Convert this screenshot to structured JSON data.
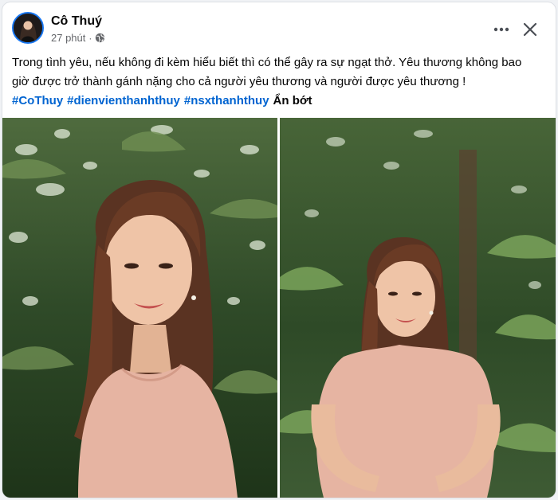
{
  "post": {
    "author": "Cô Thuý",
    "time": "27 phút",
    "separator": "·",
    "privacy_icon": "globe-icon",
    "text": "Trong tình yêu, nếu không đi kèm hiểu biết thì có thể gây ra sự ngạt thở. Yêu thương không bao giờ được trở thành gánh nặng cho cả người yêu thương và người được yêu thương !",
    "hashtags": [
      "#CoThuy",
      "#dienvienthanhthuy",
      "#nsxthanhthuy"
    ],
    "see_less": "Ẩn bớt"
  },
  "actions": {
    "more_icon": "more-options-icon",
    "close_icon": "close-icon"
  },
  "photos": [
    {
      "name": "photo-left"
    },
    {
      "name": "photo-right"
    }
  ],
  "colors": {
    "link": "#0064d1",
    "text": "#050505",
    "meta": "#65676b",
    "avatar_ring": "#1877f2"
  }
}
